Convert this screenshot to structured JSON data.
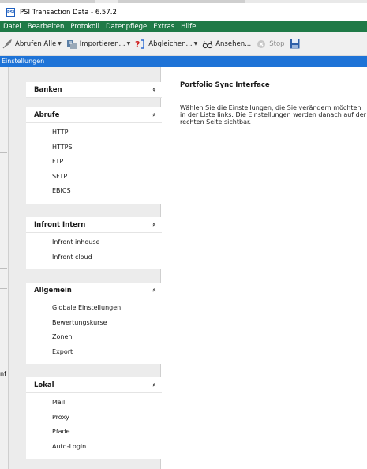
{
  "window": {
    "title": "PSI Transaction Data - 6.57.2",
    "app_icon_text": "PSI"
  },
  "menu": [
    "Datei",
    "Bearbeiten",
    "Protokoll",
    "Datenpflege",
    "Extras",
    "Hilfe"
  ],
  "toolbar": {
    "fetch_all": "Abrufen Alle",
    "import": "Importieren...",
    "reconcile": "Abgleichen...",
    "view": "Ansehen...",
    "stop": "Stop"
  },
  "panel_title": "Einstellungen",
  "background_snippet": "nf",
  "sidebar": {
    "groups": [
      {
        "title": "Banken",
        "chevron": "»",
        "items": []
      },
      {
        "title": "Abrufe",
        "chevron": "«",
        "items": [
          "HTTP",
          "HTTPS",
          "FTP",
          "SFTP",
          "EBICS"
        ]
      },
      {
        "title": "Infront Intern",
        "chevron": "«",
        "items": [
          "Infront inhouse",
          "Infront cloud"
        ]
      },
      {
        "title": "Allgemein",
        "chevron": "«",
        "items": [
          "Globale Einstellungen",
          "Bewertungskurse",
          "Zonen",
          "Export"
        ]
      },
      {
        "title": "Lokal",
        "chevron": "«",
        "items": [
          "Mail",
          "Proxy",
          "Pfade",
          "Auto-Login"
        ]
      }
    ]
  },
  "content": {
    "title": "Portfolio Sync Interface",
    "description": "Wählen Sie die Einstellungen, die Sie verändern möchten in der Liste links. Die Einstellungen werden danach auf der rechten Seite sichtbar."
  },
  "colors": {
    "menubar": "#1f7a47",
    "panelbar": "#1e73d7"
  }
}
